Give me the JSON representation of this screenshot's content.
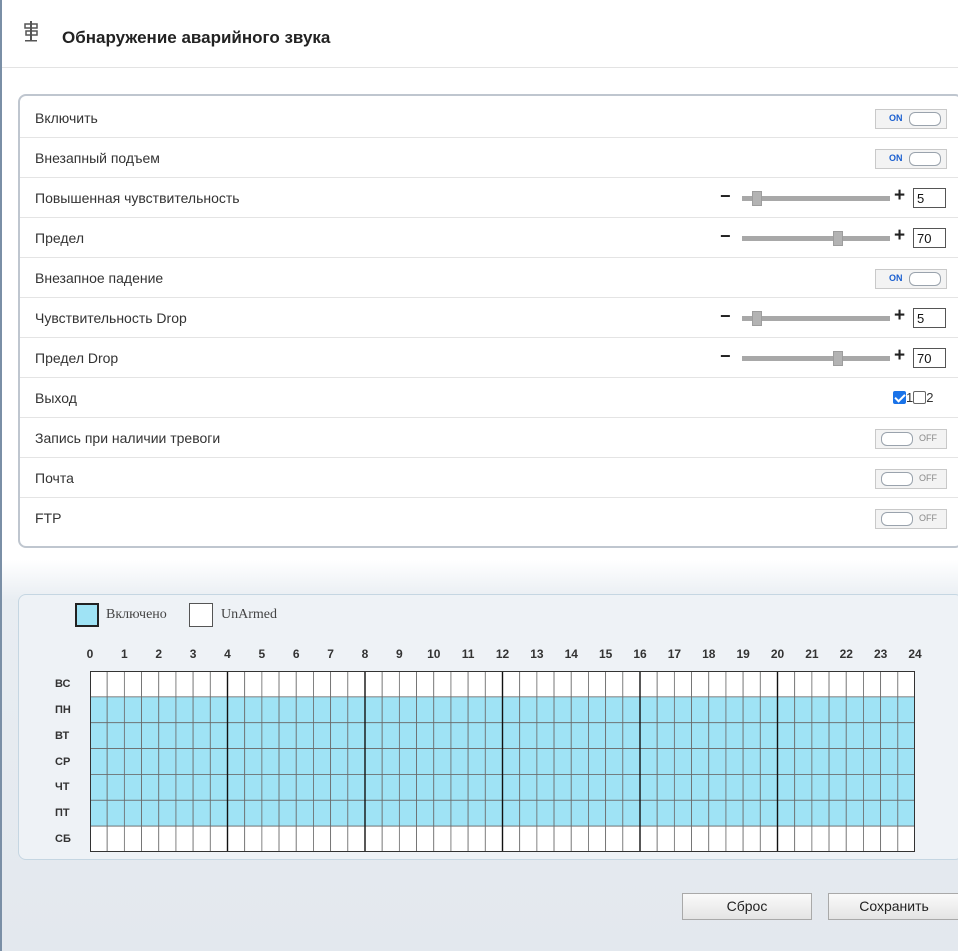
{
  "header": {
    "title": "Обнаружение аварийного звука",
    "icon": "signpost-icon"
  },
  "settings": {
    "enable": {
      "label": "Включить",
      "state": "ON"
    },
    "sudden_rise": {
      "label": "Внезапный подъем",
      "state": "ON"
    },
    "rise_sensitivity": {
      "label": "Повышенная чувствительность",
      "value": "5",
      "max": 100
    },
    "rise_limit": {
      "label": "Предел",
      "value": "70",
      "max": 100
    },
    "sudden_drop": {
      "label": "Внезапное падение",
      "state": "ON"
    },
    "drop_sensitivity": {
      "label": "Чувствительность Drop",
      "value": "5",
      "max": 100
    },
    "drop_limit": {
      "label": "Предел Drop",
      "value": "70",
      "max": 100
    },
    "output": {
      "label": "Выход",
      "opt1": "1",
      "opt1_checked": true,
      "opt2": "2",
      "opt2_checked": false
    },
    "record": {
      "label": "Запись при наличии тревоги",
      "state": "OFF"
    },
    "mail": {
      "label": "Почта",
      "state": "OFF"
    },
    "ftp": {
      "label": "FTP",
      "state": "OFF"
    }
  },
  "schedule": {
    "legend_armed": "Включено",
    "legend_unarmed": "UnArmed",
    "armed_color": "#9fe3f5",
    "hours": [
      "0",
      "1",
      "2",
      "3",
      "4",
      "5",
      "6",
      "7",
      "8",
      "9",
      "10",
      "11",
      "12",
      "13",
      "14",
      "15",
      "16",
      "17",
      "18",
      "19",
      "20",
      "21",
      "22",
      "23",
      "24"
    ],
    "days": [
      "ВС",
      "ПН",
      "ВТ",
      "СР",
      "ЧТ",
      "ПТ",
      "СБ"
    ],
    "armed_days": [
      false,
      true,
      true,
      true,
      true,
      true,
      false
    ]
  },
  "buttons": {
    "reset": "Сброс",
    "save": "Сохранить"
  }
}
